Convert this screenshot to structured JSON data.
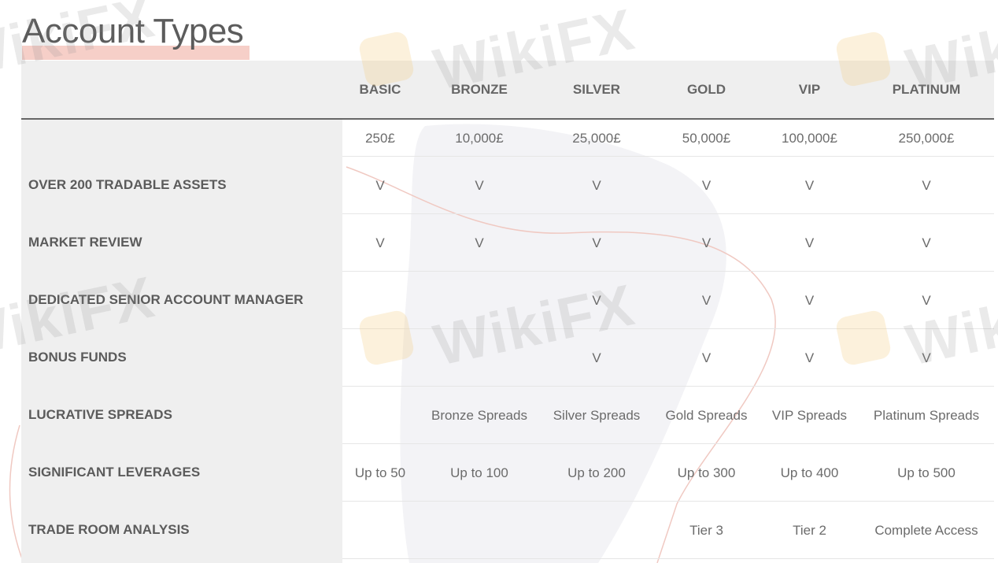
{
  "page": {
    "title": "Account Types"
  },
  "columns": [
    "BASIC",
    "BRONZE",
    "SILVER",
    "GOLD",
    "VIP",
    "PLATINUM"
  ],
  "deposits": [
    "250£",
    "10,000£",
    "25,000£",
    "50,000£",
    "100,000£",
    "250,000£"
  ],
  "features": [
    {
      "label": "OVER 200 TRADABLE ASSETS",
      "values": [
        "V",
        "V",
        "V",
        "V",
        "V",
        "V"
      ]
    },
    {
      "label": "MARKET REVIEW",
      "values": [
        "V",
        "V",
        "V",
        "V",
        "V",
        "V"
      ]
    },
    {
      "label": "DEDICATED SENIOR ACCOUNT MANAGER",
      "values": [
        "",
        "",
        "V",
        "V",
        "V",
        "V"
      ]
    },
    {
      "label": "BONUS FUNDS",
      "values": [
        "",
        "",
        "V",
        "V",
        "V",
        "V"
      ]
    },
    {
      "label": "LUCRATIVE SPREADS",
      "values": [
        "",
        "Bronze Spreads",
        "Silver Spreads",
        "Gold Spreads",
        "VIP Spreads",
        "Platinum Spreads"
      ]
    },
    {
      "label": "SIGNIFICANT LEVERAGES",
      "values": [
        "Up to 50",
        "Up to 100",
        "Up to 200",
        "Up to 300",
        "Up to 400",
        "Up to 500"
      ]
    },
    {
      "label": "TRADE ROOM ANALYSIS",
      "values": [
        "",
        "",
        "",
        "Tier 3",
        "Tier 2",
        "Complete Access"
      ]
    }
  ],
  "watermark": {
    "text": "WikiFX"
  },
  "colors": {
    "accent_underline": "#f6cfc8",
    "header_bg": "#efefef",
    "divider": "#666666"
  }
}
